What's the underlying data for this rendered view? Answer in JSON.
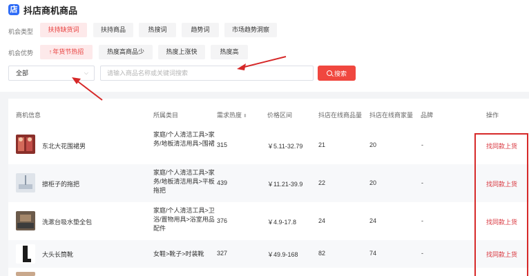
{
  "brand": {
    "title": "抖店商机商品",
    "logo_glyph": "店"
  },
  "filters": {
    "type_label": "机会类型",
    "types": [
      "扶持缺货词",
      "扶持商品",
      "热搜词",
      "趋势词",
      "市场趋势洞察"
    ],
    "advantage_label": "机会优势",
    "advantages": [
      "年货节热招",
      "热度高商品少",
      "热度上涨快",
      "热度高"
    ]
  },
  "search": {
    "select_value": "全部",
    "placeholder": "请输入商品名称或关键词搜索",
    "button_label": "搜索"
  },
  "table": {
    "headers": {
      "info": "商机信息",
      "category": "所属类目",
      "demand": "需求热度",
      "price": "价格区间",
      "goods": "抖店在线商品量",
      "merchants": "抖店在线商家量",
      "brand": "品牌",
      "action": "操作"
    },
    "rows": [
      {
        "name": "东北大花围裙男",
        "category": "家庭/个人清洁工具>家务/地板清洁用具>围裙",
        "demand": "315",
        "price": "￥5.11-32.79",
        "goods": "21",
        "merchants": "20",
        "brand": "-",
        "action": "找同款上货"
      },
      {
        "name": "擦柜子的拖把",
        "category": "家庭/个人清洁工具>家务/地板清洁用具>平板拖把",
        "demand": "439",
        "price": "￥11.21-39.9",
        "goods": "22",
        "merchants": "20",
        "brand": "-",
        "action": "找同款上货"
      },
      {
        "name": "洗漱台吸水垫全包",
        "category": "家庭/个人清洁工具>卫浴/置物用具>浴室用品配件",
        "demand": "376",
        "price": "￥4.9-17.8",
        "goods": "24",
        "merchants": "24",
        "brand": "-",
        "action": "找同款上货"
      },
      {
        "name": "大头长筒靴",
        "category": "女鞋>靴子>时装靴",
        "demand": "327",
        "price": "￥49.9-168",
        "goods": "82",
        "merchants": "74",
        "brand": "-",
        "action": "找同款上货"
      }
    ]
  },
  "colors": {
    "accent": "#f0473f",
    "brand_blue": "#2f6cf6",
    "action_red": "#d9363e",
    "annotation_red": "#d62828"
  }
}
